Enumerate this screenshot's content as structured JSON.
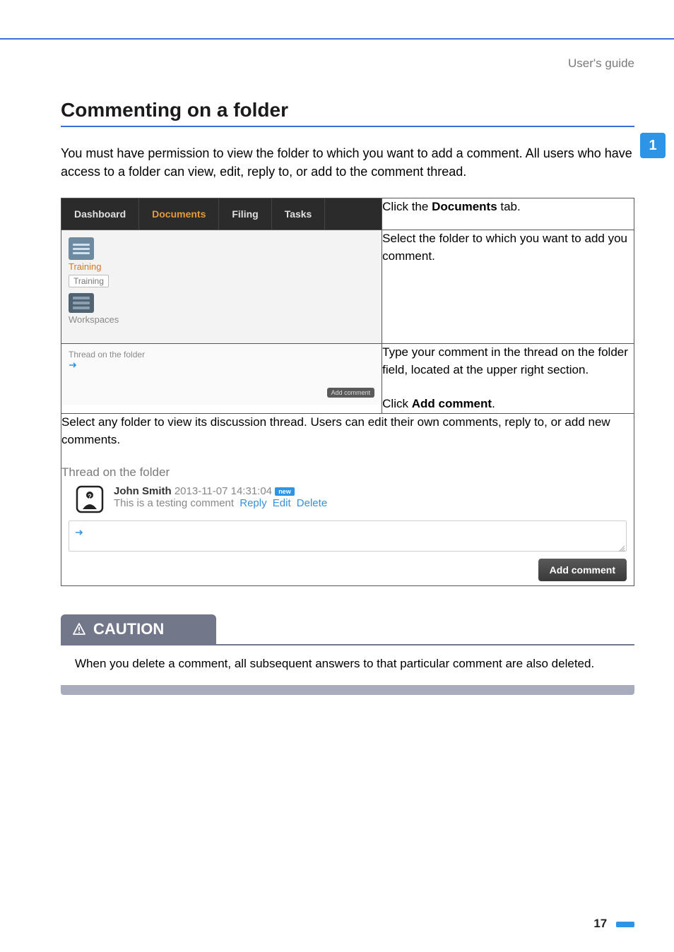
{
  "header": {
    "right_label": "User's guide"
  },
  "sidebar": {
    "chapter": "1"
  },
  "section": {
    "title": "Commenting on a folder",
    "intro": "You must have permission to view the folder to which you want to add a comment. All users who have access to a folder can view, edit, reply to, or add to the comment thread."
  },
  "tabs": {
    "items": [
      "Dashboard",
      "Documents",
      "Filing",
      "Tasks"
    ],
    "active_index": 1
  },
  "row1": {
    "text_pre": "Click the ",
    "text_bold": "Documents",
    "text_post": " tab."
  },
  "folder": {
    "label_top": "Training",
    "chip": "Training",
    "workspaces_label": "Workspaces"
  },
  "row2": {
    "text": "Select the folder to which you want to add you comment."
  },
  "thread_small": {
    "label": "Thread on the folder",
    "add_button": "Add comment"
  },
  "row3": {
    "p1": "Type your comment in the thread on the folder field, located at the upper right section.",
    "p2_pre": "Click ",
    "p2_bold": "Add comment",
    "p2_post": "."
  },
  "row4": {
    "intro": "Select any folder to view its discussion thread. Users can edit their own comments, reply to, or add new comments.",
    "thread_label": "Thread on the folder",
    "comment": {
      "author": "John Smith",
      "timestamp": "2013-11-07 14:31:04",
      "new_badge": "new",
      "body": "This is a testing comment",
      "actions": [
        "Reply",
        "Edit",
        "Delete"
      ]
    },
    "add_button": "Add comment"
  },
  "caution": {
    "title": "CAUTION",
    "body": "When you delete a comment, all subsequent answers to that particular comment are also deleted."
  },
  "page_number": "17"
}
